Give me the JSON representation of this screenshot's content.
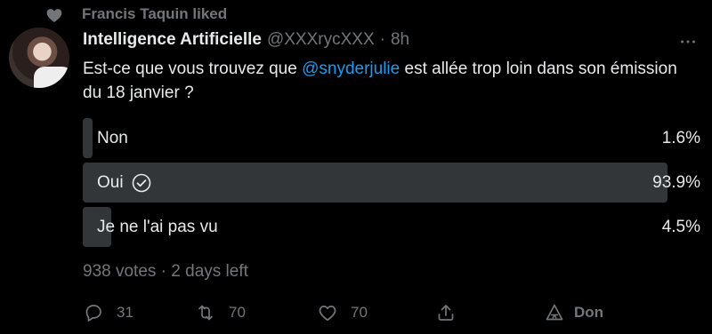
{
  "social_context": {
    "text": "Francis Taquin liked"
  },
  "author": {
    "name": "Intelligence Artificielle",
    "handle": "@XXXrycXXX",
    "separator": "·",
    "time": "8h"
  },
  "tweet": {
    "text_before": "Est-ce que vous trouvez que ",
    "mention": "@snyderjulie",
    "text_after": " est allée trop loin dans son émission du 18 janvier ?"
  },
  "poll": {
    "options": [
      {
        "label": "Non",
        "percent_text": "1.6%",
        "percent": 1.6
      },
      {
        "label": "Oui",
        "percent_text": "93.9%",
        "percent": 93.9,
        "selected": true
      },
      {
        "label": "Je ne l'ai pas vu",
        "percent_text": "4.5%",
        "percent": 4.5
      }
    ],
    "meta": "938 votes · 2 days left"
  },
  "actions": {
    "replies": "31",
    "retweets": "70",
    "likes": "70",
    "promote_label": "Don"
  },
  "colors": {
    "background": "#000000",
    "text": "#e7e9ea",
    "muted": "#71767b",
    "link": "#1d9bf0",
    "poll_bar": "#333639"
  }
}
